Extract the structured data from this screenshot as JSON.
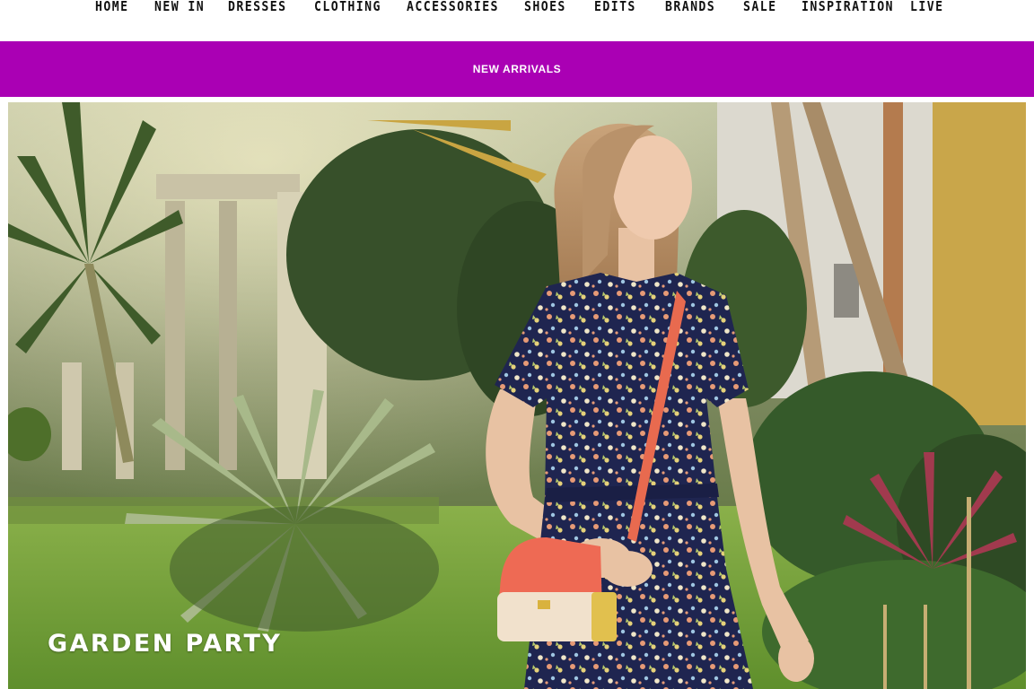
{
  "nav": {
    "items": [
      {
        "label": "HOME"
      },
      {
        "label": "NEW IN"
      },
      {
        "label": "DRESSES"
      },
      {
        "label": "CLOTHING"
      },
      {
        "label": "ACCESSORIES"
      },
      {
        "label": "SHOES"
      },
      {
        "label": "EDITS"
      },
      {
        "label": "BRANDS"
      },
      {
        "label": "SALE"
      },
      {
        "label": "INSPIRATION"
      },
      {
        "label": "LIVE"
      }
    ]
  },
  "promo": {
    "label": "NEW ARRIVALS",
    "color": "#aa00b4"
  },
  "hero": {
    "title": "GARDEN PARTY"
  }
}
